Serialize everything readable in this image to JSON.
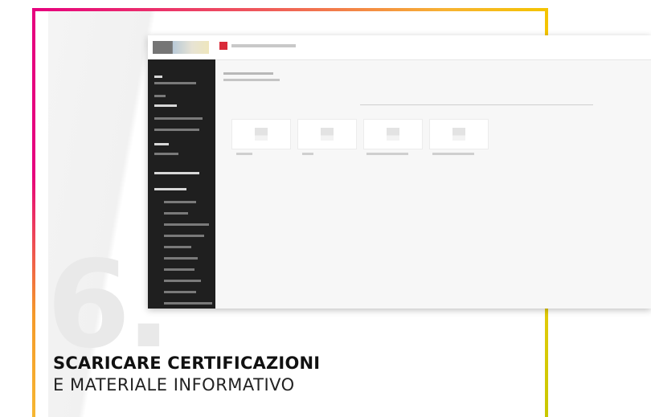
{
  "slide": {
    "number": "6.",
    "title": "SCARICARE CERTIFICAZIONI",
    "subtitle": "E MATERIALE INFORMATIVO"
  },
  "colors": {
    "frame_magenta": "#e6007e",
    "frame_orange": "#f59a2a",
    "frame_yellow": "#f4c400",
    "accent_red": "#d92b3a"
  },
  "screenshot": {
    "cards": [
      {
        "icon": "document-icon"
      },
      {
        "icon": "document-icon"
      },
      {
        "icon": "document-icon"
      },
      {
        "icon": "document-icon"
      }
    ]
  }
}
